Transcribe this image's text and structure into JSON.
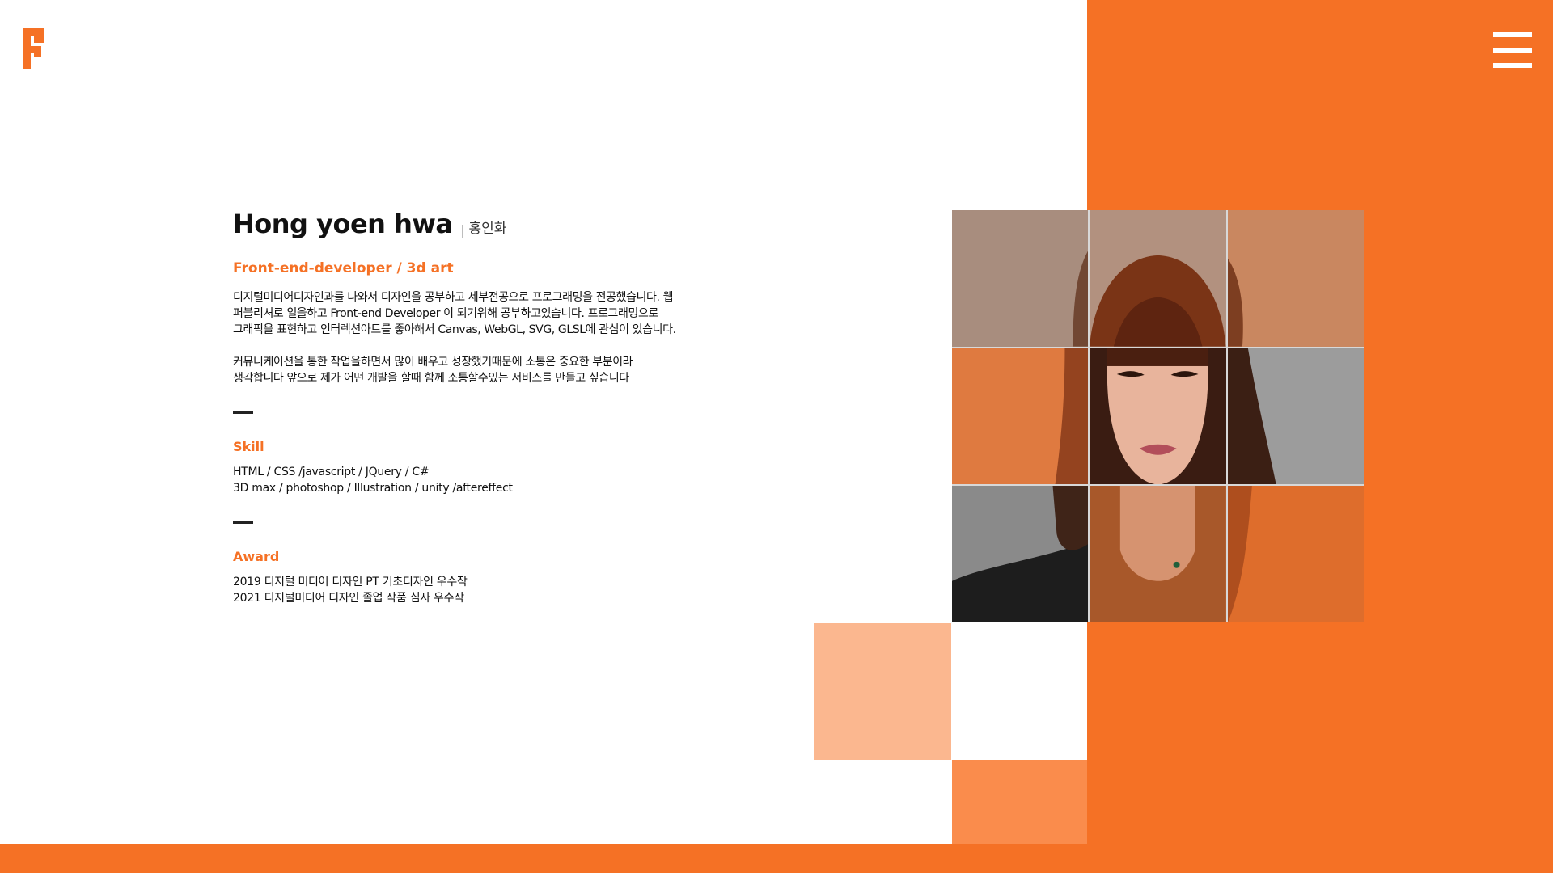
{
  "header": {
    "logo_icon": "pixel-f-logo",
    "menu_icon": "hamburger-menu-icon"
  },
  "profile": {
    "name": "Hong yoen hwa",
    "name_kr": "홍인화",
    "role": "Front-end-developer / 3d art",
    "intro_1": "디지털미디어디자인과를 나와서 디자인을 공부하고 세부전공으로 프로그래밍을 전공했습니다. 웹\n퍼블리셔로 일을하고 Front-end Developer 이 되기위해 공부하고있습니다. 프로그래밍으로\n그래픽을 표현하고 인터렉션아트를 좋아해서 Canvas, WebGL, SVG, GLSL에 관심이 있습니다.",
    "intro_2": "커뮤니케이션을 통한 작업을하면서 많이 배우고 성장했기때문에 소통은 중요한 부분이라\n생각합니다 앞으로 제가 어떤 개발을 할때 함께 소통할수있는 서비스를 만들고 싶습니다"
  },
  "skill": {
    "title": "Skill",
    "items": [
      "HTML / CSS /javascript / JQuery / C#",
      "3D max / photoshop / Illustration / unity /aftereffect"
    ]
  },
  "award": {
    "title": "Award",
    "items": [
      "2019 디지털 미디어 디자인 PT 기초디자인 우수작",
      "2021 디지털미디어 디자인 졸업 작품 심사 우수작"
    ]
  },
  "colors": {
    "accent": "#f57125",
    "accent_light": "#fbb78f",
    "accent_mid": "#fa8c4c"
  }
}
